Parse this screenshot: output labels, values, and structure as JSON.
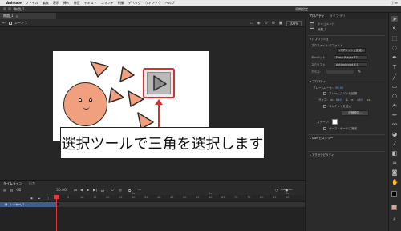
{
  "menubar": {
    "app": "Animate",
    "items": [
      "ファイル",
      "編集",
      "表示",
      "挿入",
      "修正",
      "テキスト",
      "コマンド",
      "制御",
      "デバッグ",
      "ウィンドウ",
      "ヘルプ"
    ],
    "status": "ⓘ ≡"
  },
  "titlebar": {
    "filename": "無題_1",
    "workspace": "初期設定"
  },
  "document": {
    "tab": "無題_1",
    "tab_close": "×",
    "scene": "シーン 1",
    "zoom": "100%"
  },
  "stage": {
    "callout": "選択ツールで三角を選択します",
    "colors": {
      "stage_bg": "#ffffff",
      "shape_fill": "#f0a07e",
      "highlight": "#d8302b"
    }
  },
  "panel": {
    "tabs": [
      "プロパティ",
      "ライブラリ"
    ],
    "doc_title": "ドキュメント",
    "doc_name": "無題_1",
    "publish_section": "パブリッシュ",
    "profile_label": "プロファイル:",
    "profile_value": "デフォルト",
    "publish_settings": "パブリッシュ設定...",
    "target_label": "ターゲット:",
    "target_value": "Flash Player 32",
    "script_label": "スクリプト:",
    "script_value": "ActionScript 3.0",
    "class_label": "クラス:",
    "properties_section": "プロパティ",
    "fps_label": "フレームレート:",
    "fps_value": "30.00",
    "frame_apply": "フレームスパンを拡張",
    "size_label": "サイズ:",
    "width": "640",
    "height": "480",
    "px": "px",
    "scale_content": "コンテンツを拡大",
    "advanced_settings": "詳細設定...",
    "stage_label": "ステージ:",
    "pasteboard": "ペーストボードに適用",
    "swf_section": "SWF ヒストリー",
    "accessibility_section": "アクセシビリティ"
  },
  "timeline": {
    "tabs": [
      "タイムライン",
      "出力"
    ],
    "fps_display": "30.00",
    "layer_name": "レイヤー_1",
    "ruler": [
      "1s",
      "2s",
      "3s"
    ],
    "ruler_frames": [
      "5",
      "10",
      "15",
      "20",
      "25",
      "30",
      "35",
      "40",
      "45",
      "50",
      "55",
      "60",
      "65",
      "70",
      "75",
      "80",
      "85",
      "90"
    ]
  },
  "toolbar": {
    "icons": [
      "selection-tool-icon",
      "subselection-tool-icon",
      "free-transform-icon",
      "lasso-icon",
      "pen-icon",
      "text-icon",
      "line-icon",
      "rectangle-icon",
      "oval-icon",
      "brush-icon",
      "pencil-icon",
      "bone-icon",
      "paint-bucket-icon",
      "eyedropper-icon",
      "eraser-icon",
      "width-icon",
      "camera-icon",
      "hand-icon",
      "zoom-icon"
    ]
  }
}
